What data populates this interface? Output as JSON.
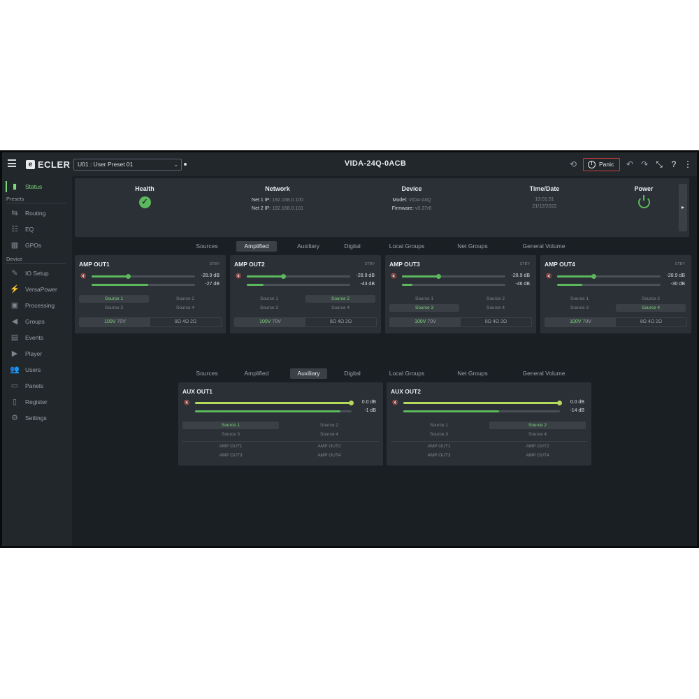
{
  "topbar": {
    "logo_text": "ECLER",
    "preset": "U01 : User Preset 01",
    "device_title": "VIDA-24Q-0ACB",
    "panic_label": "Panic",
    "icons": [
      "menu-icon",
      "link-icon",
      "undo-icon",
      "redo-icon",
      "collapse-icon",
      "help-icon",
      "more-icon"
    ]
  },
  "sidebar": {
    "status": "Status",
    "presets_header": "Presets",
    "presets": [
      "Routing",
      "EQ",
      "GPOs"
    ],
    "device_header": "Device",
    "device": [
      "IO Setup",
      "VersaPower",
      "Processing",
      "Groups",
      "Events",
      "Player",
      "Users",
      "Panels",
      "Register",
      "Settings"
    ]
  },
  "status": {
    "health": "Health",
    "network": "Network",
    "net1_label": "Net 1 IP:",
    "net1": "192.168.0.100",
    "net2_label": "Net 2 IP:",
    "net2": "192.168.0.101",
    "device": "Device",
    "model_label": "Model:",
    "model": "VIDA-24Q",
    "firmware_label": "Firmware:",
    "firmware": "v0.37r8",
    "timedate": "Time/Date",
    "time": "13:01:51",
    "date": "21/12/2022",
    "power": "Power"
  },
  "tabs": [
    "Sources",
    "Amplified",
    "Auxiliary",
    "Digital",
    "Local Groups",
    "Net Groups",
    "General Volume"
  ],
  "amp": {
    "stby": "STBY",
    "v100": "100V",
    "v70": "70V",
    "o8": "8Ω",
    "o4": "4Ω",
    "o2": "2Ω",
    "sources": [
      "Source 1",
      "Source 2",
      "Source 3",
      "Source 4"
    ],
    "outs": [
      {
        "title": "AMP OUT1",
        "vol": "-28.9 dB",
        "meter": "-27 dB",
        "vol_level": 0.35,
        "meter_level": 0.55,
        "selected": 0
      },
      {
        "title": "AMP OUT2",
        "vol": "-28.9 dB",
        "meter": "-43 dB",
        "vol_level": 0.35,
        "meter_level": 0.16,
        "selected": 1
      },
      {
        "title": "AMP OUT3",
        "vol": "-28.9 dB",
        "meter": "-46 dB",
        "vol_level": 0.35,
        "meter_level": 0.1,
        "selected": 2
      },
      {
        "title": "AMP OUT4",
        "vol": "-28.9 dB",
        "meter": "-30 dB",
        "vol_level": 0.35,
        "meter_level": 0.24,
        "selected": 3
      }
    ]
  },
  "aux": {
    "sources": [
      "Source 1",
      "Source 2",
      "Source 3",
      "Source 4"
    ],
    "amps": [
      "AMP OUT1",
      "AMP OUT2",
      "AMP OUT3",
      "AMP OUT4"
    ],
    "outs": [
      {
        "title": "AUX OUT1",
        "vol": "0.0 dB",
        "meter": "-1 dB",
        "vol_level": 1.0,
        "meter_level": 0.93,
        "selected": 0
      },
      {
        "title": "AUX OUT2",
        "vol": "0.0 dB",
        "meter": "-14 dB",
        "vol_level": 1.0,
        "meter_level": 0.61,
        "selected": 1
      }
    ]
  },
  "colors": {
    "accent": "#7dd87a",
    "panic": "#c94040",
    "lime": "#b5d95a"
  }
}
